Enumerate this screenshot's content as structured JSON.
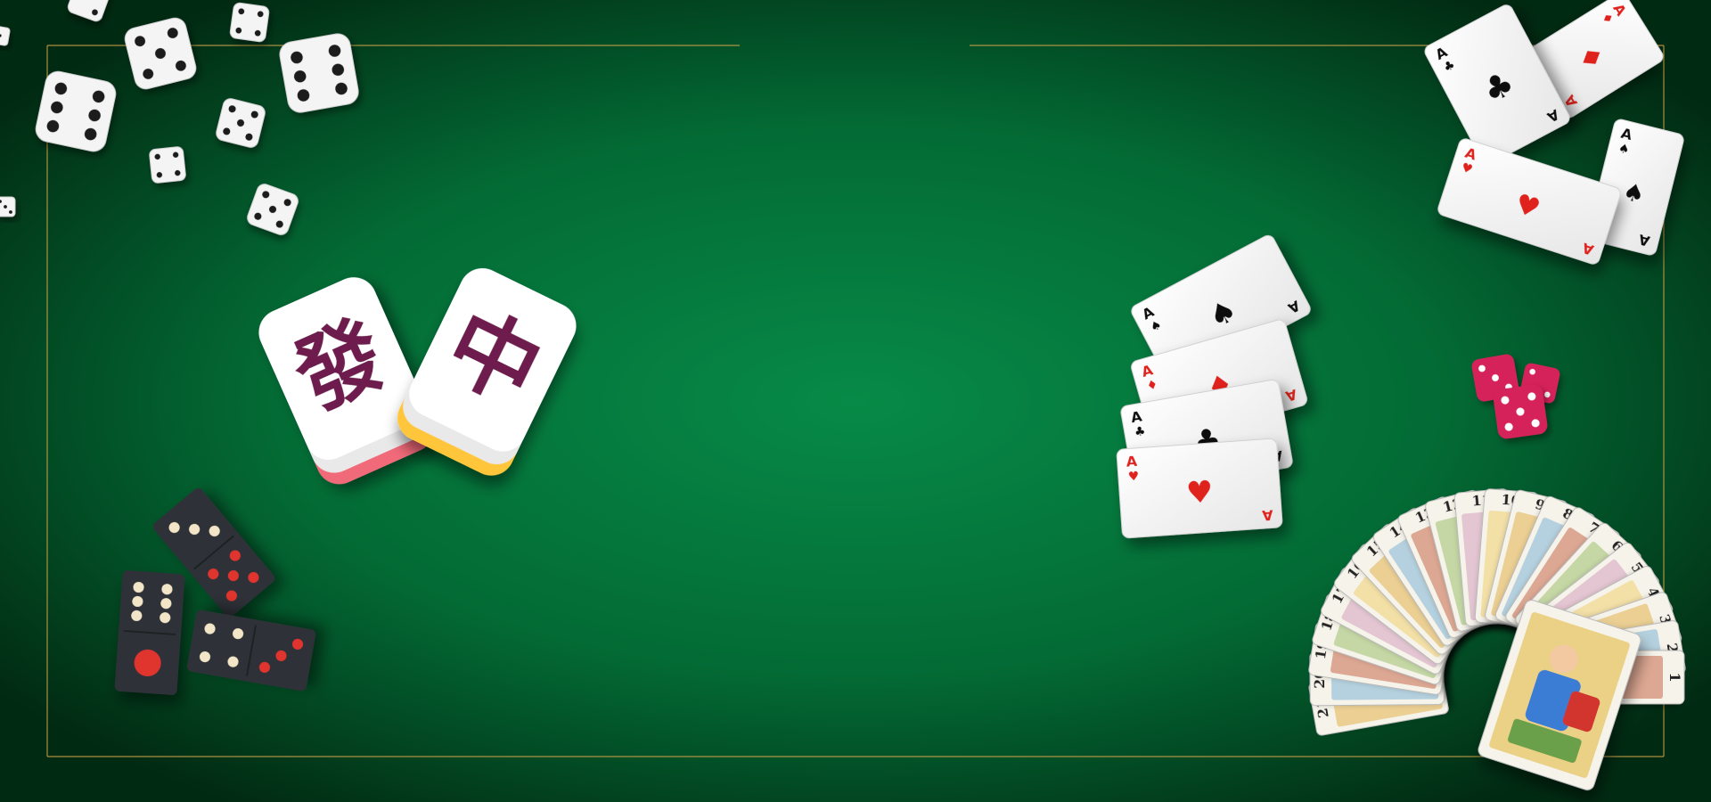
{
  "table": {
    "felt_center": "#078a47",
    "felt_edge": "#012a12",
    "frame_color": "#c9a14a"
  },
  "mahjong": [
    {
      "glyph": "發",
      "glyph_color": "#6e1f4e",
      "back_color": "#f06a7a"
    },
    {
      "glyph": "中",
      "glyph_color": "#6e1f4e",
      "back_color": "#ffc63a"
    }
  ],
  "ace_stack": [
    {
      "rank": "A",
      "suit": "♥",
      "suit_color": "#e0201b"
    },
    {
      "rank": "A",
      "suit": "♣",
      "suit_color": "#111111"
    },
    {
      "rank": "A",
      "suit": "♦",
      "suit_color": "#e0201b"
    },
    {
      "rank": "A",
      "suit": "♠",
      "suit_color": "#111111"
    }
  ],
  "flying_cards": [
    {
      "rank": "A",
      "suit": "♣",
      "suit_color": "#111111"
    },
    {
      "rank": "A",
      "suit": "♦",
      "suit_color": "#e0201b"
    },
    {
      "rank": "A",
      "suit": "♥",
      "suit_color": "#e0201b"
    },
    {
      "rank": "A",
      "suit": "♠",
      "suit_color": "#111111"
    }
  ],
  "tarot_fan": {
    "numbers": [
      "21",
      "20",
      "19",
      "18",
      "17",
      "16",
      "15",
      "14",
      "13",
      "12",
      "11",
      "10",
      "9",
      "8",
      "7",
      "6",
      "5",
      "4",
      "3",
      "2",
      "1"
    ]
  },
  "dice_color": "#f4f4f4",
  "red_dice_color": "#d6245a",
  "domino_color": "#2f3337"
}
